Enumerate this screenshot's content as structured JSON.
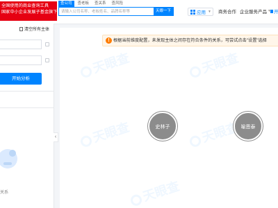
{
  "header": {
    "brand_line1": "全国使用的商业查询工具",
    "brand_line2": "国家中小企业发展子基金旗下机构",
    "search_tabs": [
      "查公司",
      "查老板",
      "查关系",
      "查风险"
    ],
    "search_placeholder": "请输入公司名称、老板姓名、品牌名称等",
    "search_button": "天眼一下",
    "app_label": "应用",
    "nav_items": [
      "商务合作",
      "企业服务产品"
    ],
    "right_cut_label": "开"
  },
  "sidebar": {
    "clear_label": "清空所有主体",
    "field1_value": "",
    "field2_value": "",
    "analyze_button": "开始分析",
    "bottom_label": "关系"
  },
  "main": {
    "notice": "根据当前维度配置，未发现主体之间存在符合条件的关系，可尝试点击\"设置\"选择",
    "watermark": "天眼查",
    "nodes": [
      {
        "label": "史林子"
      },
      {
        "label": "喻恩泰"
      }
    ]
  },
  "colors": {
    "primary": "#0084ff",
    "brand_red": "#e60012",
    "warning": "#ff7d00",
    "node_gray": "#8c8c8c"
  }
}
